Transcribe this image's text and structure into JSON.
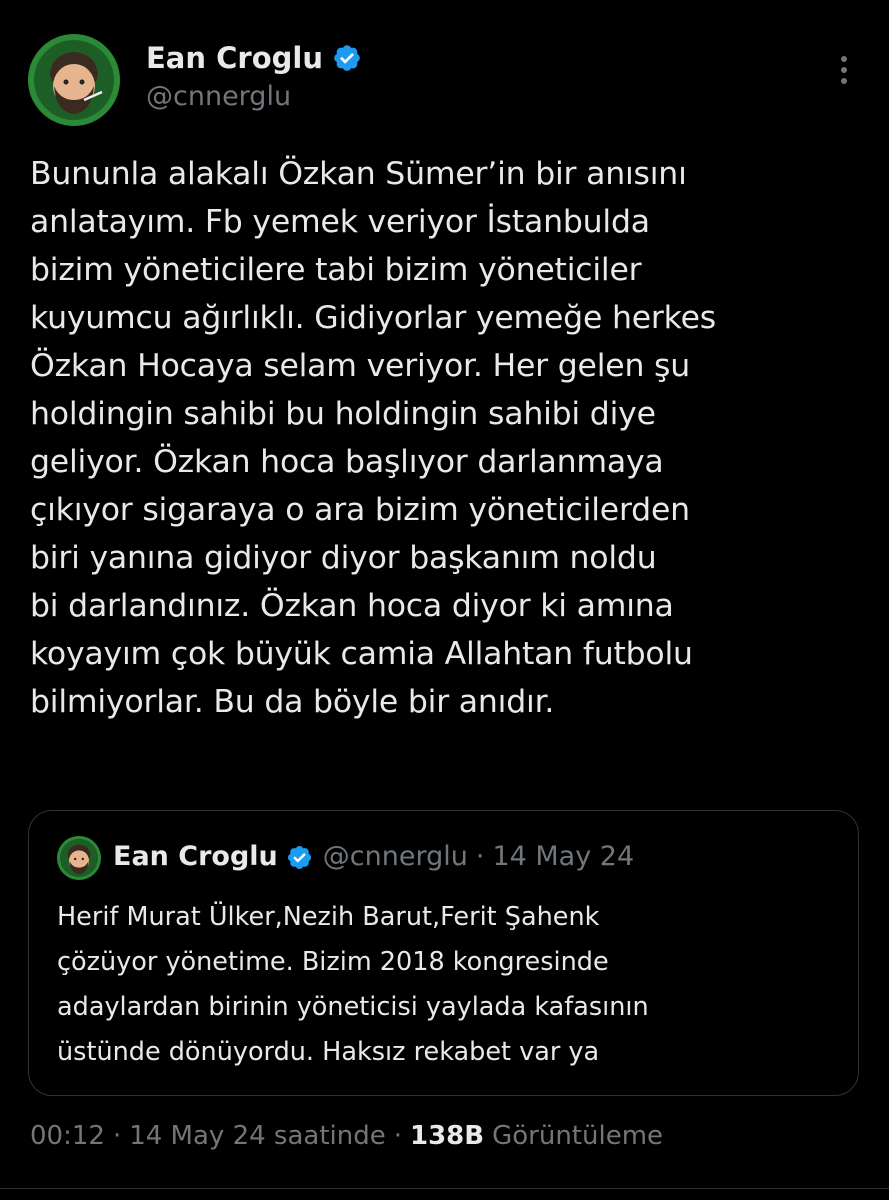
{
  "author": {
    "display_name": "Ean Croglu",
    "handle": "@cnnerglu",
    "verified": true,
    "avatar_icon": "avatar-bearded-man-icon",
    "verified_icon": "verified-badge-icon"
  },
  "more_icon": "more-vertical-icon",
  "tweet": {
    "text": "Bununla alakalı Özkan Sümer’in bir anısını\nanlatayım. Fb yemek veriyor İstanbulda\nbizim yöneticilere tabi bizim yöneticiler\nkuyumcu ağırlıklı. Gidiyorlar yemeğe herkes\nÖzkan Hocaya selam veriyor. Her gelen şu\nholdingin sahibi bu holdingin sahibi diye\ngeliyor. Özkan hoca başlıyor darlanmaya\nçıkıyor sigaraya o ara bizim yöneticilerden\nbiri yanına gidiyor diyor başkanım noldu\nbi darlandınız. Özkan hoca diyor ki amına\nkoyayım çok büyük camia Allahtan futbolu\nbilmiyorlar. Bu da böyle bir anıdır."
  },
  "quote": {
    "display_name": "Ean Croglu",
    "handle": "@cnnerglu",
    "separator": "·",
    "date": "14 May 24",
    "text": "Herif Murat Ülker,Nezih Barut,Ferit Şahenk\nçözüyor yönetime. Bizim 2018 kongresinde\nadaylardan birinin yöneticisi yaylada kafasının\nüstünde dönüyordu. Haksız rekabet var ya"
  },
  "meta": {
    "time": "00:12",
    "separator": "·",
    "date": "14 May 24 saatinde",
    "views_count": "138B",
    "views_label": "Görüntüleme"
  },
  "colors": {
    "background": "#000000",
    "text": "#e7e9ea",
    "secondary": "#71767b",
    "verified": "#1d9bf0",
    "border": "#2f3336"
  }
}
